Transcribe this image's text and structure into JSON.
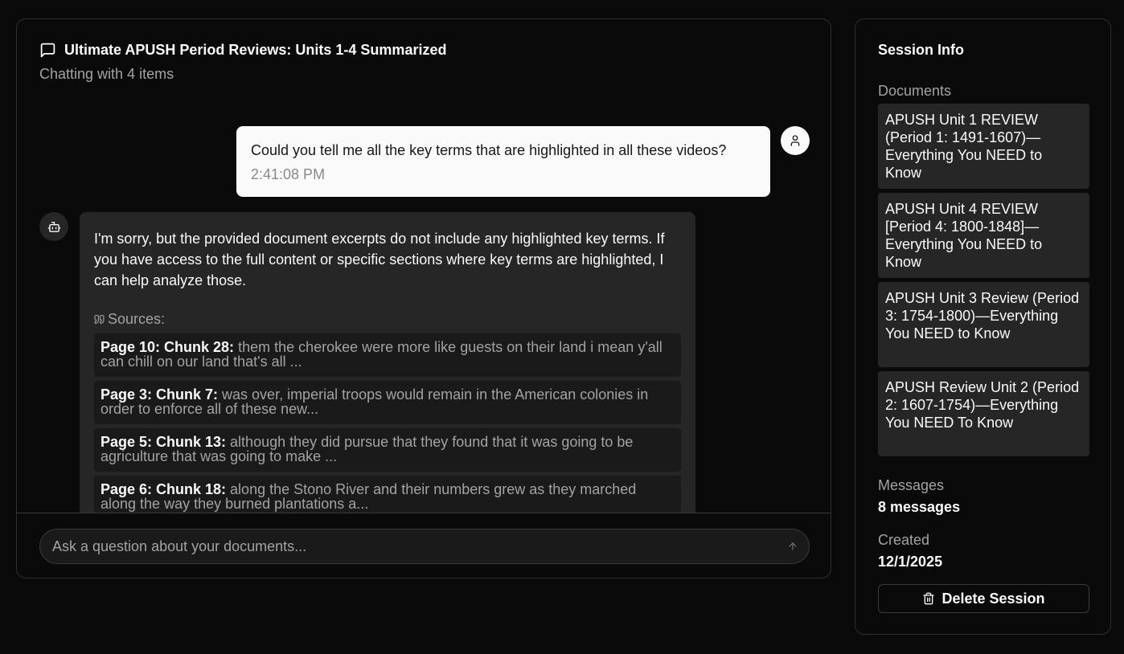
{
  "chat": {
    "title": "Ultimate APUSH Period Reviews: Units 1-4 Summarized",
    "subtitle": "Chatting with 4 items",
    "user_message": {
      "text": "Could you tell me all the key terms that are highlighted in all these videos?",
      "time": "2:41:08 PM"
    },
    "bot_message": {
      "text": "I'm sorry, but the provided document excerpts do not include any highlighted key terms. If you have access to the full content or specific sections where key terms are highlighted, I can help analyze those.",
      "sources_label": "Sources:",
      "sources": [
        {
          "ref": "Page 10: Chunk 28:",
          "excerpt": " them the cherokee were more like guests on their land i mean y'all can chill on our land that's all ..."
        },
        {
          "ref": "Page 3: Chunk 7:",
          "excerpt": " was over, imperial troops would remain in the American colonies in order to enforce all of these new..."
        },
        {
          "ref": "Page 5: Chunk 13:",
          "excerpt": " although they did pursue that they found that it was going to be agriculture that was going to make ..."
        },
        {
          "ref": "Page 6: Chunk 18:",
          "excerpt": " along the Stono River and their numbers grew as they marched along the way they burned plantations a..."
        }
      ]
    },
    "input_placeholder": "Ask a question about your documents..."
  },
  "session": {
    "title": "Session Info",
    "documents_label": "Documents",
    "documents": [
      "APUSH Unit 1 REVIEW (Period 1: 1491-1607)—Everything You NEED to Know",
      "APUSH Unit 4 REVIEW [Period 4: 1800-1848]—Everything You NEED to Know",
      "APUSH Unit 3 Review (Period 3: 1754-1800)—Everything You NEED to Know",
      "APUSH Review Unit 2 (Period 2: 1607-1754)—Everything You NEED To Know"
    ],
    "messages_label": "Messages",
    "messages_value": "8 messages",
    "created_label": "Created",
    "created_value": "12/1/2025",
    "delete_label": "Delete Session"
  },
  "icons": {
    "title": "message-square-icon",
    "user_avatar": "user-icon",
    "bot_avatar": "bot-icon",
    "sources": "quote-icon",
    "send": "arrow-up-icon",
    "delete": "trash-icon"
  },
  "colors": {
    "background": "#0a0a0a",
    "panel_border": "#2e2e2e",
    "user_bubble": "#fafafa",
    "bot_bubble": "#262626",
    "source_item": "#1a1a1a",
    "muted_text": "#a3a3a3"
  }
}
